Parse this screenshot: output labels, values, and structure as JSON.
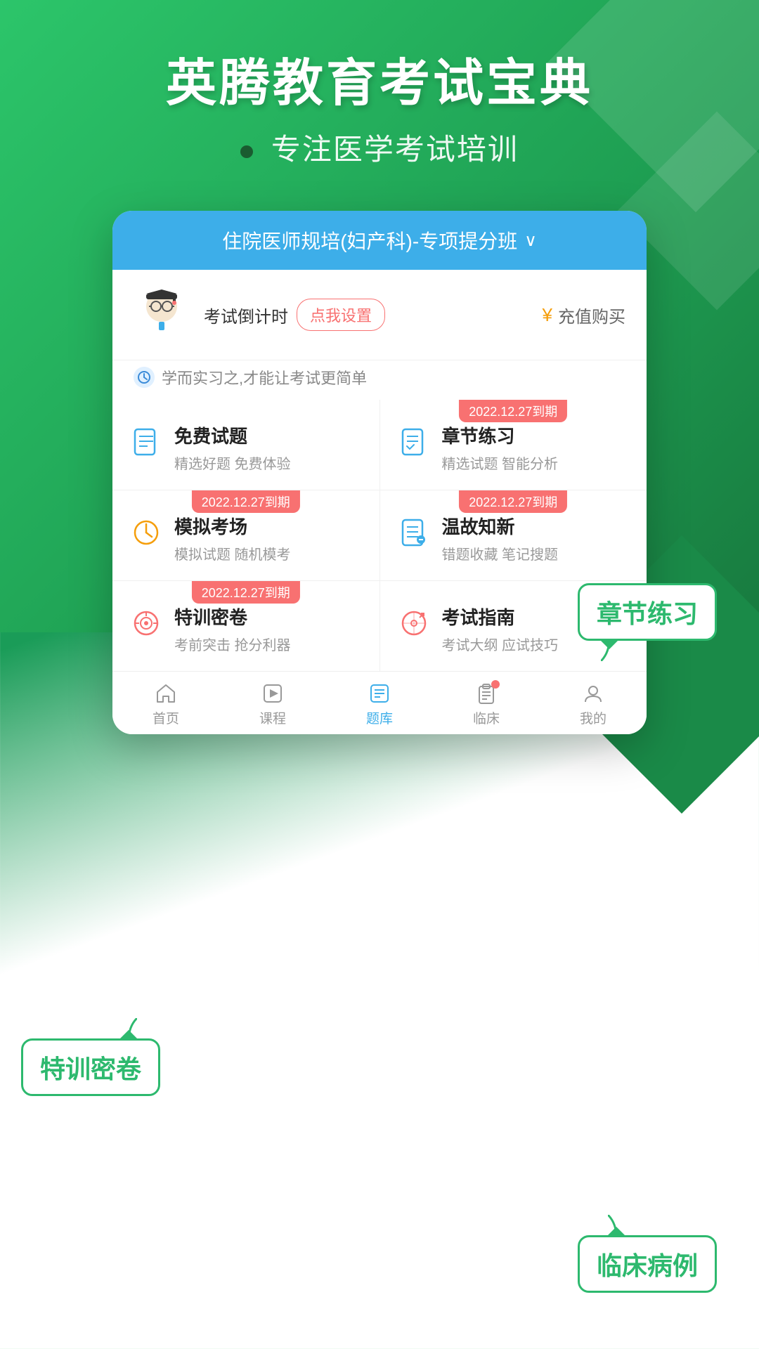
{
  "app": {
    "title": "英腾教育考试宝典",
    "subtitle": "专注医学考试培训"
  },
  "course_header": {
    "text": "住院医师规培(妇产科)-专项提分班",
    "chevron": "∨"
  },
  "countdown": {
    "label": "考试倒计时",
    "set_button": "点我设置",
    "recharge_label": "充值购买"
  },
  "motto": {
    "text": "学而实习之,才能让考试更简单"
  },
  "cards": [
    {
      "id": "free-questions",
      "title": "免费试题",
      "desc": "精选好题 免费体验",
      "expiry": null,
      "icon_type": "doc"
    },
    {
      "id": "chapter-practice",
      "title": "章节练习",
      "desc": "精选试题 智能分析",
      "expiry": "2022.12.27到期",
      "icon_type": "edit-list"
    },
    {
      "id": "mock-exam",
      "title": "模拟考场",
      "desc": "模拟试题 随机模考",
      "expiry": "2022.12.27到期",
      "icon_type": "clock"
    },
    {
      "id": "review",
      "title": "温故知新",
      "desc": "错题收藏 笔记搜题",
      "expiry": "2022.12.27到期",
      "icon_type": "edit-check"
    },
    {
      "id": "secret-exam",
      "title": "特训密卷",
      "desc": "考前突击 抢分利器",
      "expiry": "2022.12.27到期",
      "icon_type": "target"
    },
    {
      "id": "exam-guide",
      "title": "考试指南",
      "desc": "考试大纲 应试技巧",
      "expiry": null,
      "icon_type": "compass"
    }
  ],
  "bottom_nav": [
    {
      "id": "home",
      "label": "首页",
      "icon": "home",
      "active": false
    },
    {
      "id": "course",
      "label": "课程",
      "icon": "play",
      "active": false
    },
    {
      "id": "question-bank",
      "label": "题库",
      "icon": "list",
      "active": true
    },
    {
      "id": "clinical",
      "label": "临床",
      "icon": "clipboard",
      "active": false,
      "has_dot": true
    },
    {
      "id": "mine",
      "label": "我的",
      "icon": "user",
      "active": false
    }
  ],
  "callouts": {
    "chapter": "章节练习",
    "secret": "特训密卷",
    "clinical": "临床病例"
  }
}
